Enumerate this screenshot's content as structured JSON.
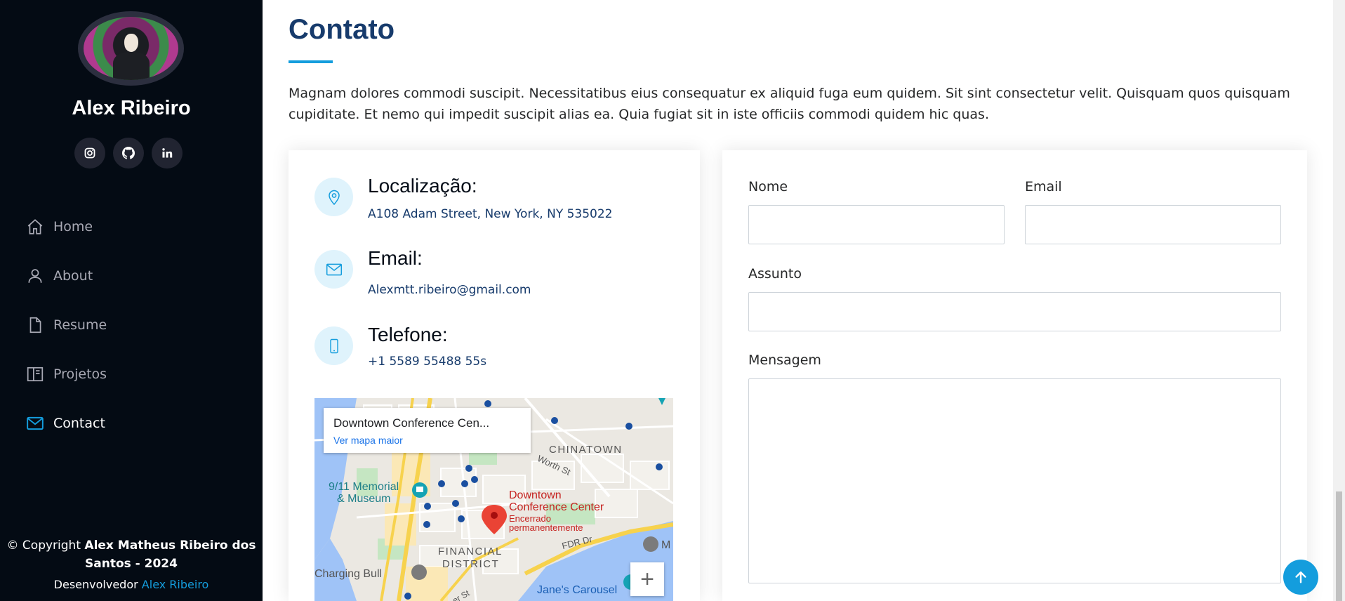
{
  "sidebar": {
    "name": "Alex Ribeiro",
    "socials": [
      {
        "icon": "instagram-icon"
      },
      {
        "icon": "github-icon"
      },
      {
        "icon": "linkedin-icon"
      }
    ],
    "nav": [
      {
        "label": "Home",
        "icon": "home-icon"
      },
      {
        "label": "About",
        "icon": "person-icon"
      },
      {
        "label": "Resume",
        "icon": "file-icon"
      },
      {
        "label": "Projetos",
        "icon": "book-icon"
      },
      {
        "label": "Contact",
        "icon": "envelope-icon",
        "active": true
      }
    ],
    "footer": {
      "copyright_prefix": "© Copyright",
      "copyright_owner": "Alex Matheus Ribeiro dos Santos - 2024",
      "dev_prefix": "Desenvolvedor",
      "dev_link": "Alex Ribeiro"
    }
  },
  "contact": {
    "title": "Contato",
    "intro": "Magnam dolores commodi suscipit. Necessitatibus eius consequatur ex aliquid fuga eum quidem. Sit sint consectetur velit. Quisquam quos quisquam cupiditate. Et nemo qui impedit suscipit alias ea. Quia fugiat sit in iste officiis commodi quidem hic quas.",
    "info": {
      "location_title": "Localização:",
      "location_text": "A108 Adam Street, New York, NY 535022",
      "email_title": "Email:",
      "email_text": "Alexmtt.ribeiro@gmail.com",
      "phone_title": "Telefone:",
      "phone_text": "+1 5589 55488 55s"
    },
    "map": {
      "place_name": "Downtown Conference Cen...",
      "larger_map_link": "Ver mapa maior",
      "labels": {
        "chinatown": "CHINATOWN",
        "worth_st": "Worth St",
        "memorial_1": "9/11 Memorial",
        "memorial_2": "& Museum",
        "pin_1": "Downtown",
        "pin_2": "Conference Center",
        "pin_3": "Encerrado",
        "pin_4": "permanentemente",
        "fdr": "FDR Dr",
        "financial_1": "FINANCIAL",
        "financial_2": "DISTRICT",
        "charging_bull": "Charging Bull",
        "janes_carousel": "Jane's Carousel",
        "m_label": "M",
        "st_label": "er St"
      },
      "zoom_in_label": "+"
    },
    "form": {
      "name_label": "Nome",
      "email_label": "Email",
      "subject_label": "Assunto",
      "message_label": "Mensagem",
      "name_value": "",
      "email_value": "",
      "subject_value": "",
      "message_value": ""
    }
  },
  "colors": {
    "accent": "#149ddd",
    "title": "#173b6c",
    "sidebar_bg": "#040b14"
  },
  "back_to_top_icon": "arrow-up-icon"
}
